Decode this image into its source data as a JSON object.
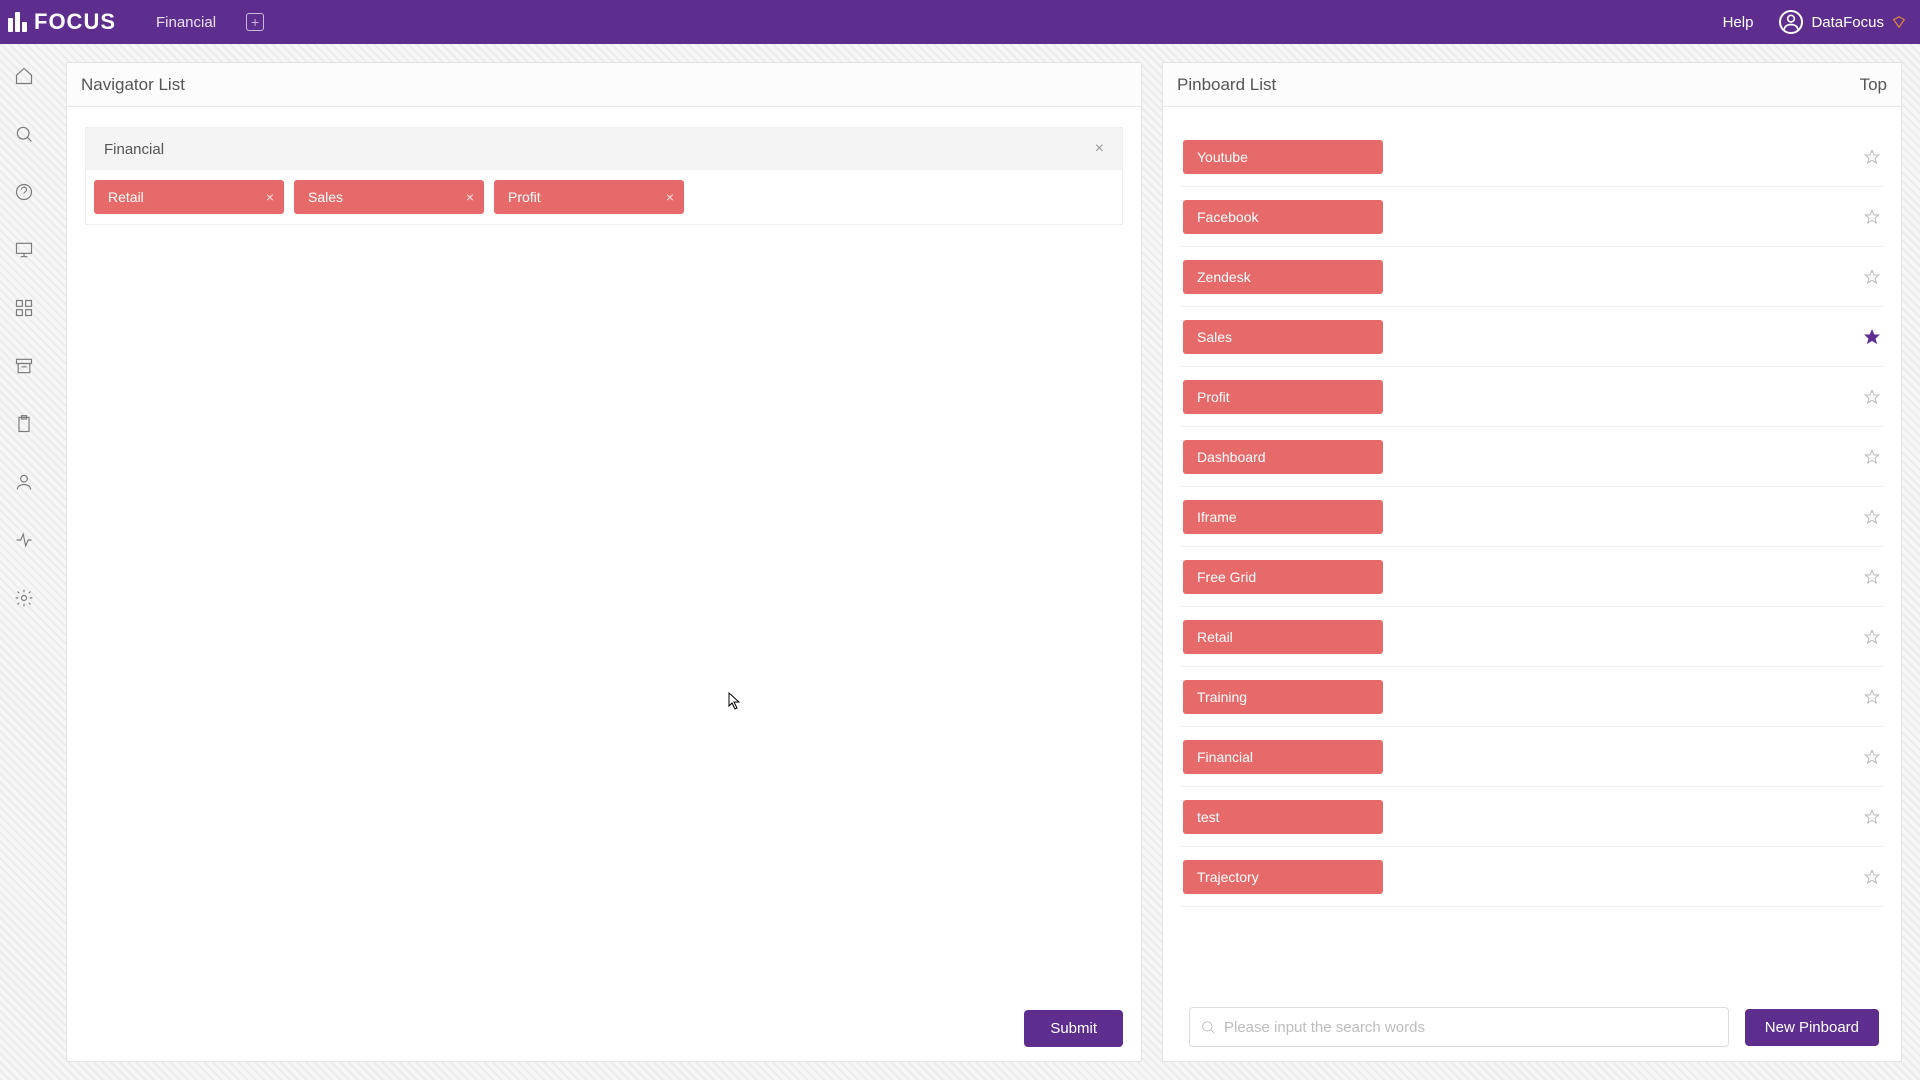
{
  "header": {
    "logo_text": "FOCUS",
    "tab_label": "Financial",
    "help_label": "Help",
    "user_name": "DataFocus"
  },
  "navigator": {
    "title": "Navigator List",
    "section_label": "Financial",
    "tags": [
      "Retail",
      "Sales",
      "Profit"
    ],
    "submit_label": "Submit"
  },
  "pinboard": {
    "title": "Pinboard List",
    "top_label": "Top",
    "items": [
      {
        "label": "Youtube",
        "starred": false
      },
      {
        "label": "Facebook",
        "starred": false
      },
      {
        "label": "Zendesk",
        "starred": false
      },
      {
        "label": "Sales",
        "starred": true
      },
      {
        "label": "Profit",
        "starred": false
      },
      {
        "label": "Dashboard",
        "starred": false
      },
      {
        "label": "Iframe",
        "starred": false
      },
      {
        "label": "Free Grid",
        "starred": false
      },
      {
        "label": "Retail",
        "starred": false
      },
      {
        "label": "Training",
        "starred": false
      },
      {
        "label": "Financial",
        "starred": false
      },
      {
        "label": "test",
        "starred": false
      },
      {
        "label": "Trajectory",
        "starred": false
      }
    ],
    "search_placeholder": "Please input the search words",
    "new_pinboard_label": "New Pinboard"
  },
  "colors": {
    "primary": "#5d2e8e",
    "tag": "#e76a6a"
  }
}
